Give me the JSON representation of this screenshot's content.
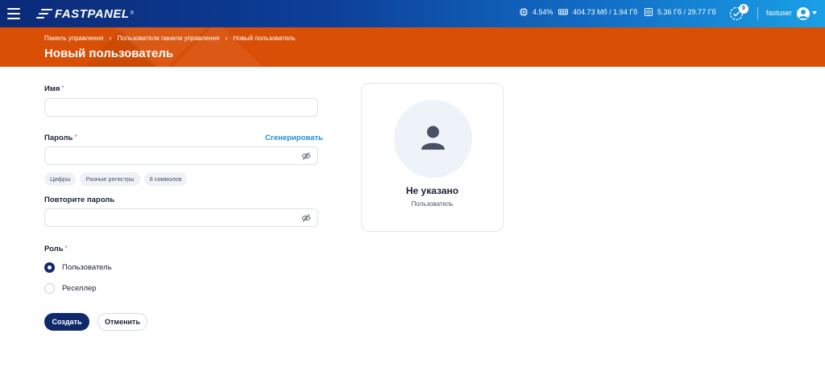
{
  "app": {
    "logo_text": "FASTPANEL",
    "logo_reg": "®"
  },
  "topbar": {
    "cpu": "4.54%",
    "ram": "404.73 Мб / 1.94 Гб",
    "disk": "5.36 Гб / 29.77 Гб",
    "notifications_count": "0",
    "username": "fastuser"
  },
  "header": {
    "breadcrumbs": [
      "Панель управления",
      "Пользователи панели управления",
      "Новый пользователь"
    ],
    "title": "Новый пользователь"
  },
  "form": {
    "name_label": "Имя",
    "name_value": "",
    "password_label": "Пароль",
    "password_value": "",
    "generate_label": "Сгенерировать",
    "password_hints": [
      "Цифры",
      "Разные регистры",
      "8 символов"
    ],
    "repeat_password_label": "Повторите пароль",
    "repeat_password_value": "",
    "role_label": "Роль",
    "required_mark": "*",
    "roles": [
      {
        "label": "Пользователь",
        "checked": true
      },
      {
        "label": "Реселлер",
        "checked": false
      }
    ],
    "create_label": "Создать",
    "cancel_label": "Отменить"
  },
  "profile_card": {
    "name": "Не указано",
    "role": "Пользователь"
  },
  "colors": {
    "topbar_start": "#0b2a78",
    "topbar_end": "#1aa0e6",
    "header_orange": "#d94f06",
    "primary_button": "#0f2a6b",
    "link": "#1d8fd3",
    "required": "#e5484d"
  }
}
